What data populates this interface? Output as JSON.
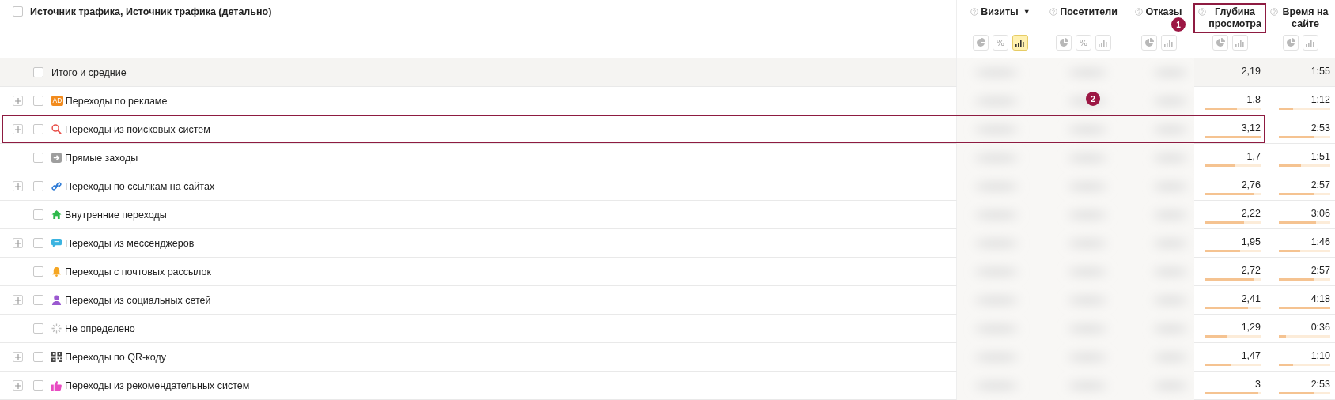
{
  "table": {
    "header": {
      "checked": false,
      "title": "Источник трафика, Источник трафика (детально)"
    },
    "metrics": [
      {
        "title": "Визиты",
        "sort": "▼",
        "highlighted": false,
        "views": [
          {
            "kind": "pie",
            "selected": false
          },
          {
            "kind": "percent",
            "label": "%",
            "selected": false
          },
          {
            "kind": "bars",
            "selected": true
          }
        ]
      },
      {
        "title": "Посетители",
        "highlighted": false,
        "views": [
          {
            "kind": "pie",
            "selected": false
          },
          {
            "kind": "percent",
            "label": "%",
            "selected": false
          },
          {
            "kind": "bars",
            "selected": false
          }
        ]
      },
      {
        "title": "Отказы",
        "highlighted": false,
        "views": [
          {
            "kind": "pie",
            "selected": false
          },
          {
            "kind": "bars",
            "selected": false
          }
        ]
      },
      {
        "title": "Глубина просмотра",
        "highlighted": true,
        "views": [
          {
            "kind": "pie",
            "selected": false
          },
          {
            "kind": "bars",
            "selected": false
          }
        ]
      },
      {
        "title": "Время на сайте",
        "highlighted": false,
        "views": [
          {
            "kind": "pie",
            "selected": false
          },
          {
            "kind": "bars",
            "selected": false
          }
        ]
      }
    ],
    "rows": [
      {
        "kind": "total",
        "label": "Итого и средние",
        "expandable": false,
        "checked": false,
        "highlighted": false,
        "depth": "2,19",
        "time": "1:55"
      },
      {
        "kind": "ad",
        "badge": "AD",
        "label": "Переходы по рекламе",
        "expandable": true,
        "checked": false,
        "highlighted": false,
        "depth": "1,8",
        "depth_bar": {
          "level": 0.58
        },
        "time": "1:12",
        "time_bar": {
          "level": 0.28
        }
      },
      {
        "kind": "search",
        "label": "Переходы из поисковых систем",
        "expandable": true,
        "checked": false,
        "highlighted": true,
        "depth": "3,12",
        "depth_bar": {
          "level": 1
        },
        "time": "2:53",
        "time_bar": {
          "level": 0.67
        }
      },
      {
        "kind": "direct",
        "label": "Прямые заходы",
        "expandable": false,
        "checked": false,
        "highlighted": false,
        "depth": "1,7",
        "depth_bar": {
          "level": 0.55
        },
        "time": "1:51",
        "time_bar": {
          "level": 0.43
        }
      },
      {
        "kind": "link",
        "label": "Переходы по ссылкам на сайтах",
        "expandable": true,
        "checked": false,
        "highlighted": false,
        "depth": "2,76",
        "depth_bar": {
          "level": 0.88
        },
        "time": "2:57",
        "time_bar": {
          "level": 0.69
        }
      },
      {
        "kind": "internal",
        "label": "Внутренние переходы",
        "expandable": false,
        "checked": false,
        "highlighted": false,
        "depth": "2,22",
        "depth_bar": {
          "level": 0.71
        },
        "time": "3:06",
        "time_bar": {
          "level": 0.72
        }
      },
      {
        "kind": "messenger",
        "label": "Переходы из мессенджеров",
        "expandable": true,
        "checked": false,
        "highlighted": false,
        "depth": "1,95",
        "depth_bar": {
          "level": 0.63
        },
        "time": "1:46",
        "time_bar": {
          "level": 0.41
        }
      },
      {
        "kind": "mail",
        "label": "Переходы с почтовых рассылок",
        "expandable": false,
        "checked": false,
        "highlighted": false,
        "depth": "2,72",
        "depth_bar": {
          "level": 0.87
        },
        "time": "2:57",
        "time_bar": {
          "level": 0.69
        }
      },
      {
        "kind": "social",
        "label": "Переходы из социальных сетей",
        "expandable": true,
        "checked": false,
        "highlighted": false,
        "depth": "2,41",
        "depth_bar": {
          "level": 0.77
        },
        "time": "4:18",
        "time_bar": {
          "level": 1
        }
      },
      {
        "kind": "undefined",
        "label": "Не определено",
        "expandable": false,
        "checked": false,
        "highlighted": false,
        "depth": "1,29",
        "depth_bar": {
          "level": 0.41
        },
        "time": "0:36",
        "time_bar": {
          "level": 0.14
        }
      },
      {
        "kind": "qr",
        "label": "Переходы по QR-коду",
        "expandable": true,
        "checked": false,
        "highlighted": false,
        "depth": "1,47",
        "depth_bar": {
          "level": 0.47
        },
        "time": "1:10",
        "time_bar": {
          "level": 0.27
        }
      },
      {
        "kind": "recommend",
        "label": "Переходы из рекомендательных систем",
        "expandable": true,
        "checked": false,
        "highlighted": false,
        "depth": "3",
        "depth_bar": {
          "level": 0.96
        },
        "time": "2:53",
        "time_bar": {
          "level": 0.67
        }
      }
    ]
  },
  "annotations": [
    {
      "number": "1"
    },
    {
      "number": "2"
    }
  ]
}
